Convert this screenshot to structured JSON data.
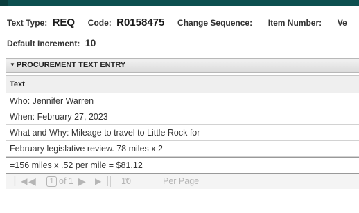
{
  "header": {
    "text_type_label": "Text Type:",
    "text_type_value": "REQ",
    "code_label": "Code:",
    "code_value": "R0158475",
    "change_sequence_label": "Change Sequence:",
    "item_number_label": "Item Number:",
    "cut_off_label": "Ve"
  },
  "default_increment": {
    "label": "Default Increment:",
    "value": "10"
  },
  "panel": {
    "title": "PROCUREMENT TEXT ENTRY",
    "column_header": "Text",
    "rows": [
      "Who: Jennifer Warren",
      "When: February 27, 2023",
      "What and Why: Mileage to travel to Little Rock for",
      "February legislative review. 78 miles x 2",
      "=156 miles x .52 per mile = $81.12"
    ]
  },
  "pager": {
    "page": "1",
    "of_text": "of 1",
    "per_page_value": "10",
    "per_page_label": "Per Page"
  }
}
